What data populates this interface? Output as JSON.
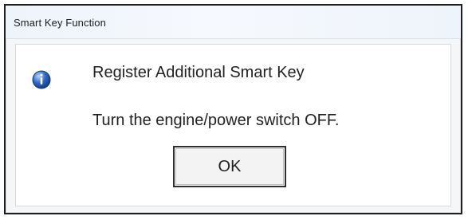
{
  "dialog": {
    "title": "Smart Key Function",
    "heading": "Register Additional Smart Key",
    "message": "Turn the engine/power switch OFF.",
    "button_label": "OK",
    "icon": "info-icon"
  },
  "colors": {
    "accent": "#1f5fbf",
    "text": "#222222",
    "border": "#1f1f1f",
    "background": "#ffffff"
  }
}
